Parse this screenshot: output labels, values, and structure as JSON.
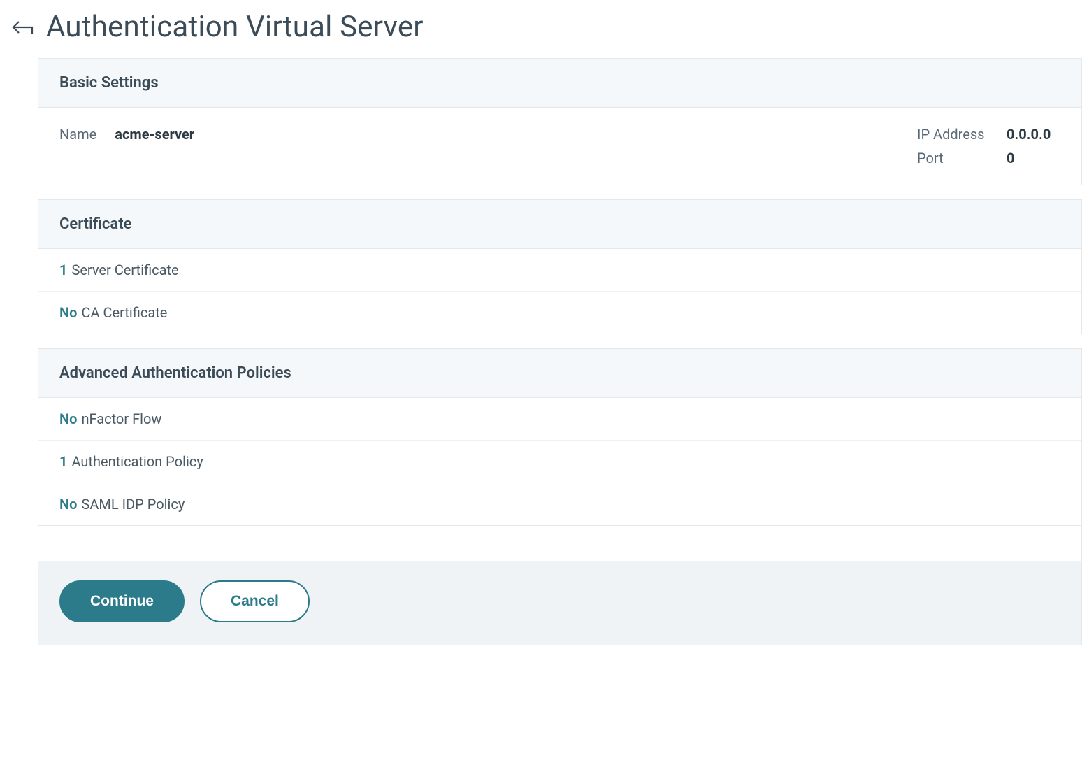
{
  "header": {
    "title": "Authentication Virtual Server"
  },
  "basic_settings": {
    "section_title": "Basic Settings",
    "name_label": "Name",
    "name_value": "acme-server",
    "ip_label": "IP Address",
    "ip_value": "0.0.0.0",
    "port_label": "Port",
    "port_value": "0"
  },
  "certificate": {
    "section_title": "Certificate",
    "rows": [
      {
        "count": "1",
        "label": "Server Certificate"
      },
      {
        "count": "No",
        "label": "CA Certificate"
      }
    ]
  },
  "advanced_auth": {
    "section_title": "Advanced Authentication Policies",
    "rows": [
      {
        "count": "No",
        "label": "nFactor Flow"
      },
      {
        "count": "1",
        "label": "Authentication Policy"
      },
      {
        "count": "No",
        "label": "SAML IDP Policy"
      }
    ]
  },
  "footer": {
    "continue_label": "Continue",
    "cancel_label": "Cancel"
  }
}
